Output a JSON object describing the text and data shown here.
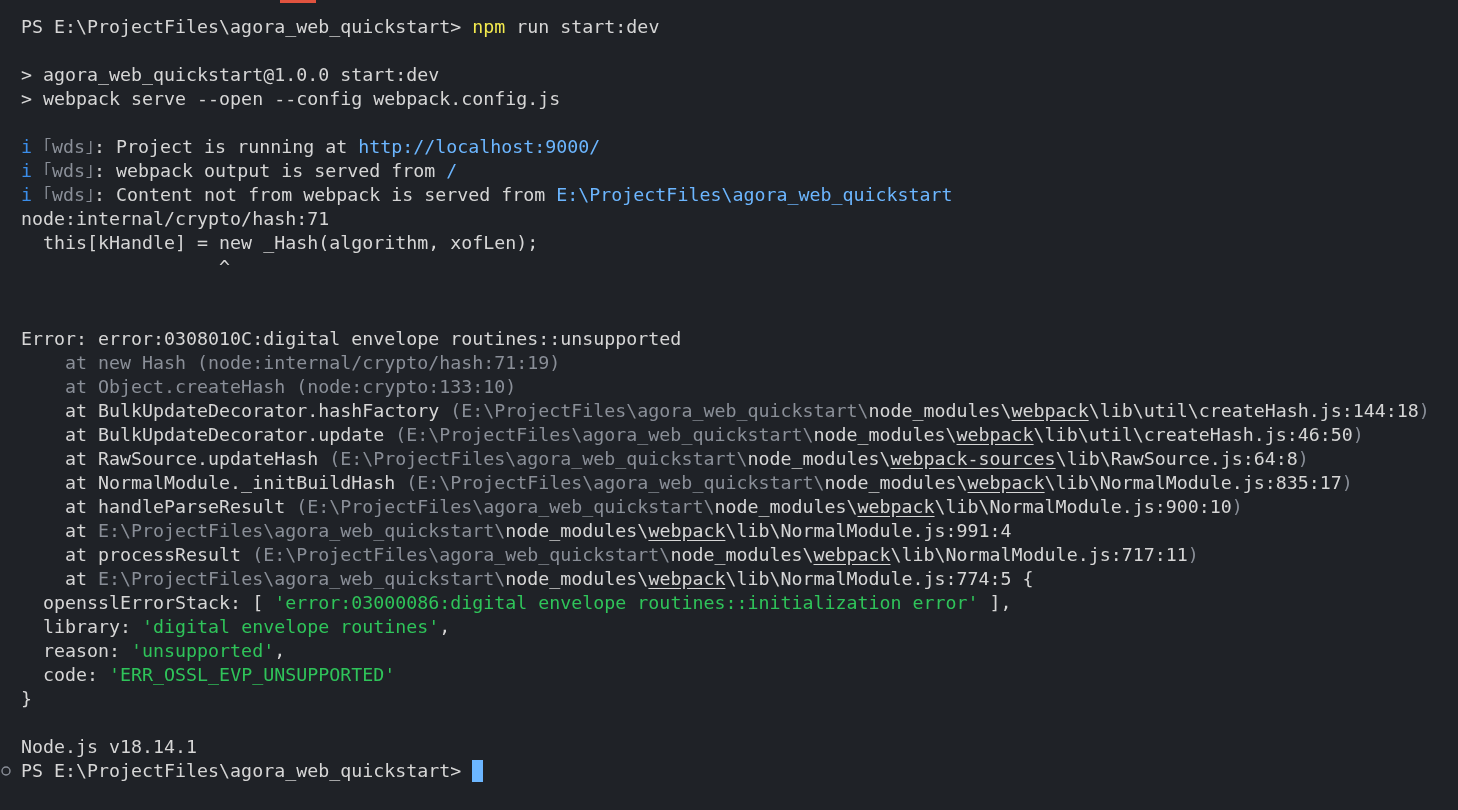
{
  "terminal": {
    "lines": [
      {
        "kind": "text",
        "segments": [
          {
            "kind": "plain",
            "text": "PS E:\\ProjectFiles\\agora_web_quickstart> "
          },
          {
            "kind": "cmd",
            "text": "npm"
          },
          {
            "kind": "plain",
            "text": " run start:dev"
          }
        ]
      },
      {
        "kind": "blank"
      },
      {
        "kind": "text",
        "segments": [
          {
            "kind": "plain",
            "text": "> agora_web_quickstart@1.0.0 start:dev"
          }
        ]
      },
      {
        "kind": "text",
        "segments": [
          {
            "kind": "plain",
            "text": "> webpack serve --open --config webpack.config.js"
          }
        ]
      },
      {
        "kind": "blank"
      },
      {
        "kind": "text",
        "segments": [
          {
            "kind": "info",
            "text": "i"
          },
          {
            "kind": "dim",
            "text": " ｢wds｣"
          },
          {
            "kind": "plain",
            "text": ": Project is running at "
          },
          {
            "kind": "link",
            "text": "http://localhost:9000/"
          }
        ]
      },
      {
        "kind": "text",
        "segments": [
          {
            "kind": "info",
            "text": "i"
          },
          {
            "kind": "dim",
            "text": " ｢wds｣"
          },
          {
            "kind": "plain",
            "text": ": webpack output is served from "
          },
          {
            "kind": "link",
            "text": "/"
          }
        ]
      },
      {
        "kind": "text",
        "segments": [
          {
            "kind": "info",
            "text": "i"
          },
          {
            "kind": "dim",
            "text": " ｢wds｣"
          },
          {
            "kind": "plain",
            "text": ": Content not from webpack is served from "
          },
          {
            "kind": "link",
            "text": "E:\\ProjectFiles\\agora_web_quickstart"
          }
        ]
      },
      {
        "kind": "text",
        "segments": [
          {
            "kind": "plain",
            "text": "node:internal/crypto/hash:71"
          }
        ]
      },
      {
        "kind": "text",
        "segments": [
          {
            "kind": "plain",
            "text": "  this[kHandle] = new _Hash(algorithm, xofLen);"
          }
        ]
      },
      {
        "kind": "text",
        "segments": [
          {
            "kind": "plain",
            "text": "                  ^"
          }
        ]
      },
      {
        "kind": "blank"
      },
      {
        "kind": "blank"
      },
      {
        "kind": "text",
        "segments": [
          {
            "kind": "plain",
            "text": "Error: error:0308010C:digital envelope routines::unsupported"
          }
        ]
      },
      {
        "kind": "text",
        "segments": [
          {
            "kind": "dim",
            "text": "    at new Hash (node:internal/crypto/hash:71:19)"
          }
        ]
      },
      {
        "kind": "text",
        "segments": [
          {
            "kind": "dim",
            "text": "    at Object.createHash (node:crypto:133:10)"
          }
        ]
      },
      {
        "kind": "text",
        "segments": [
          {
            "kind": "plain",
            "text": "    at BulkUpdateDecorator.hashFactory "
          },
          {
            "kind": "dim",
            "text": "(E:\\ProjectFiles\\agora_web_quickstart\\"
          },
          {
            "kind": "plain",
            "text": "node_modules\\"
          },
          {
            "kind": "under",
            "text": "webpack"
          },
          {
            "kind": "plain",
            "text": "\\lib\\util\\createHash.js:144:18"
          },
          {
            "kind": "dim",
            "text": ")"
          }
        ]
      },
      {
        "kind": "text",
        "segments": [
          {
            "kind": "plain",
            "text": "    at BulkUpdateDecorator.update "
          },
          {
            "kind": "dim",
            "text": "(E:\\ProjectFiles\\agora_web_quickstart\\"
          },
          {
            "kind": "plain",
            "text": "node_modules\\"
          },
          {
            "kind": "under",
            "text": "webpack"
          },
          {
            "kind": "plain",
            "text": "\\lib\\util\\createHash.js:46:50"
          },
          {
            "kind": "dim",
            "text": ")"
          }
        ]
      },
      {
        "kind": "text",
        "segments": [
          {
            "kind": "plain",
            "text": "    at RawSource.updateHash "
          },
          {
            "kind": "dim",
            "text": "(E:\\ProjectFiles\\agora_web_quickstart\\"
          },
          {
            "kind": "plain",
            "text": "node_modules\\"
          },
          {
            "kind": "under",
            "text": "webpack-sources"
          },
          {
            "kind": "plain",
            "text": "\\lib\\RawSource.js:64:8"
          },
          {
            "kind": "dim",
            "text": ")"
          }
        ]
      },
      {
        "kind": "text",
        "segments": [
          {
            "kind": "plain",
            "text": "    at NormalModule._initBuildHash "
          },
          {
            "kind": "dim",
            "text": "(E:\\ProjectFiles\\agora_web_quickstart\\"
          },
          {
            "kind": "plain",
            "text": "node_modules\\"
          },
          {
            "kind": "under",
            "text": "webpack"
          },
          {
            "kind": "plain",
            "text": "\\lib\\NormalModule.js:835:17"
          },
          {
            "kind": "dim",
            "text": ")"
          }
        ]
      },
      {
        "kind": "text",
        "segments": [
          {
            "kind": "plain",
            "text": "    at handleParseResult "
          },
          {
            "kind": "dim",
            "text": "(E:\\ProjectFiles\\agora_web_quickstart\\"
          },
          {
            "kind": "plain",
            "text": "node_modules\\"
          },
          {
            "kind": "under",
            "text": "webpack"
          },
          {
            "kind": "plain",
            "text": "\\lib\\NormalModule.js:900:10"
          },
          {
            "kind": "dim",
            "text": ")"
          }
        ]
      },
      {
        "kind": "text",
        "segments": [
          {
            "kind": "plain",
            "text": "    at "
          },
          {
            "kind": "dim",
            "text": "E:\\ProjectFiles\\agora_web_quickstart\\"
          },
          {
            "kind": "plain",
            "text": "node_modules\\"
          },
          {
            "kind": "under",
            "text": "webpack"
          },
          {
            "kind": "plain",
            "text": "\\lib\\NormalModule.js:991:4"
          }
        ]
      },
      {
        "kind": "text",
        "segments": [
          {
            "kind": "plain",
            "text": "    at processResult "
          },
          {
            "kind": "dim",
            "text": "(E:\\ProjectFiles\\agora_web_quickstart\\"
          },
          {
            "kind": "plain",
            "text": "node_modules\\"
          },
          {
            "kind": "under",
            "text": "webpack"
          },
          {
            "kind": "plain",
            "text": "\\lib\\NormalModule.js:717:11"
          },
          {
            "kind": "dim",
            "text": ")"
          }
        ]
      },
      {
        "kind": "text",
        "segments": [
          {
            "kind": "plain",
            "text": "    at "
          },
          {
            "kind": "dim",
            "text": "E:\\ProjectFiles\\agora_web_quickstart\\"
          },
          {
            "kind": "plain",
            "text": "node_modules\\"
          },
          {
            "kind": "under",
            "text": "webpack"
          },
          {
            "kind": "plain",
            "text": "\\lib\\NormalModule.js:774:5 {"
          }
        ]
      },
      {
        "kind": "text",
        "segments": [
          {
            "kind": "plain",
            "text": "  opensslErrorStack: [ "
          },
          {
            "kind": "str",
            "text": "'error:03000086:digital envelope routines::initialization error'"
          },
          {
            "kind": "plain",
            "text": " ],"
          }
        ]
      },
      {
        "kind": "text",
        "segments": [
          {
            "kind": "plain",
            "text": "  library: "
          },
          {
            "kind": "str",
            "text": "'digital envelope routines'"
          },
          {
            "kind": "plain",
            "text": ","
          }
        ]
      },
      {
        "kind": "text",
        "segments": [
          {
            "kind": "plain",
            "text": "  reason: "
          },
          {
            "kind": "str",
            "text": "'unsupported'"
          },
          {
            "kind": "plain",
            "text": ","
          }
        ]
      },
      {
        "kind": "text",
        "segments": [
          {
            "kind": "plain",
            "text": "  code: "
          },
          {
            "kind": "str",
            "text": "'ERR_OSSL_EVP_UNSUPPORTED'"
          }
        ]
      },
      {
        "kind": "text",
        "segments": [
          {
            "kind": "plain",
            "text": "}"
          }
        ]
      },
      {
        "kind": "blank"
      },
      {
        "kind": "text",
        "segments": [
          {
            "kind": "plain",
            "text": "Node.js v18.14.1"
          }
        ]
      },
      {
        "kind": "active_prompt",
        "segments": [
          {
            "kind": "plain",
            "text": "PS E:\\ProjectFiles\\agora_web_quickstart> "
          }
        ]
      }
    ]
  }
}
